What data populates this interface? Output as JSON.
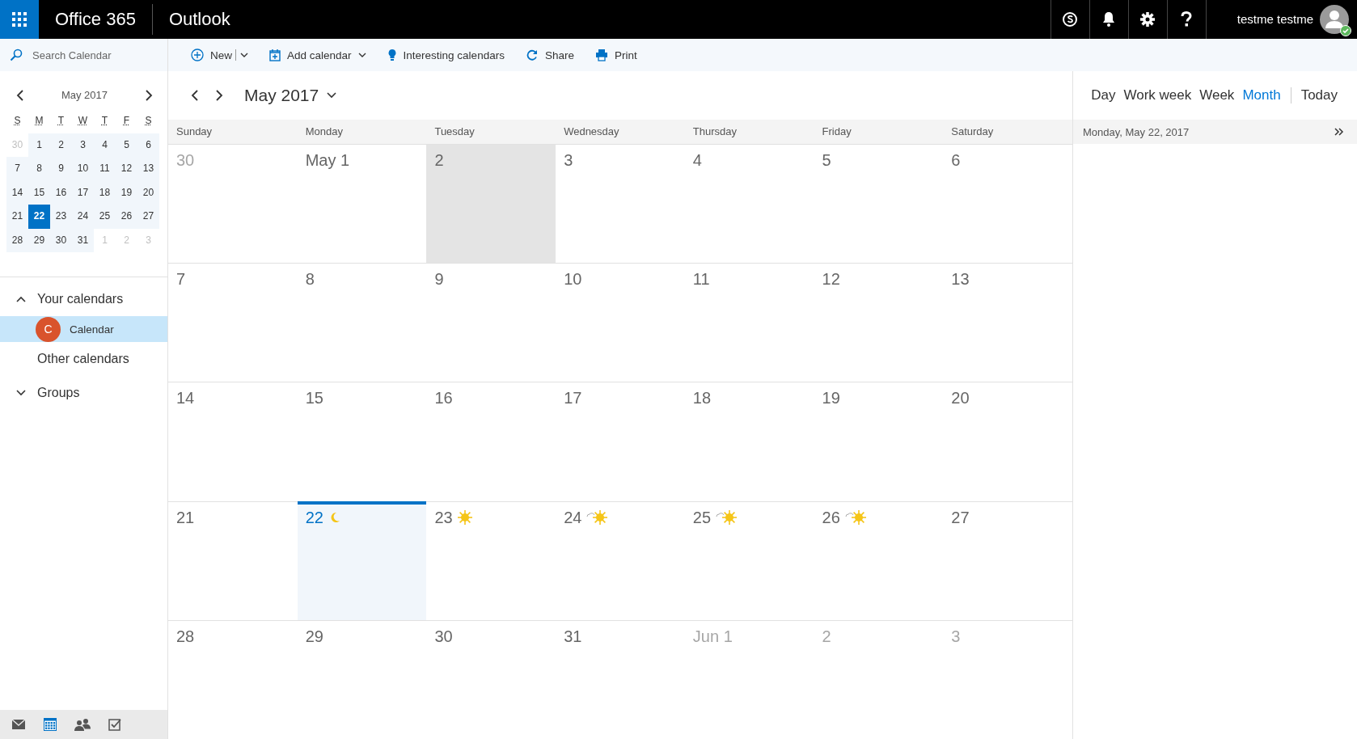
{
  "top_bar": {
    "suite": "Office 365",
    "app": "Outlook",
    "icons": [
      {
        "kind": "skype"
      },
      {
        "kind": "bell"
      },
      {
        "kind": "gear"
      },
      {
        "kind": "help"
      }
    ],
    "user": "testme testme",
    "online": true
  },
  "toolbar": {
    "search": {
      "placeholder": "Search Calendar"
    },
    "actions": [
      {
        "kind": "new",
        "label": "New",
        "split": true,
        "dropdown": true
      },
      {
        "kind": "add",
        "label": "Add calendar",
        "split": false,
        "dropdown": true
      },
      {
        "kind": "bulb",
        "label": "Interesting calendars",
        "split": false,
        "dropdown": false
      },
      {
        "kind": "share",
        "label": "Share",
        "split": false,
        "dropdown": false
      },
      {
        "kind": "print",
        "label": "Print",
        "split": false,
        "dropdown": false
      }
    ]
  },
  "mini_calendar": {
    "title": "May 2017",
    "weekdays": [
      "S",
      "M",
      "T",
      "W",
      "T",
      "F",
      "S"
    ],
    "weeks": [
      [
        {
          "day": "30",
          "muted": true,
          "selected": false
        },
        {
          "day": "1",
          "muted": false,
          "selected": false
        },
        {
          "day": "2",
          "muted": false,
          "selected": false
        },
        {
          "day": "3",
          "muted": false,
          "selected": false
        },
        {
          "day": "4",
          "muted": false,
          "selected": false
        },
        {
          "day": "5",
          "muted": false,
          "selected": false
        },
        {
          "day": "6",
          "muted": false,
          "selected": false
        }
      ],
      [
        {
          "day": "7",
          "muted": false,
          "selected": false
        },
        {
          "day": "8",
          "muted": false,
          "selected": false
        },
        {
          "day": "9",
          "muted": false,
          "selected": false
        },
        {
          "day": "10",
          "muted": false,
          "selected": false
        },
        {
          "day": "11",
          "muted": false,
          "selected": false
        },
        {
          "day": "12",
          "muted": false,
          "selected": false
        },
        {
          "day": "13",
          "muted": false,
          "selected": false
        }
      ],
      [
        {
          "day": "14",
          "muted": false,
          "selected": false
        },
        {
          "day": "15",
          "muted": false,
          "selected": false
        },
        {
          "day": "16",
          "muted": false,
          "selected": false
        },
        {
          "day": "17",
          "muted": false,
          "selected": false
        },
        {
          "day": "18",
          "muted": false,
          "selected": false
        },
        {
          "day": "19",
          "muted": false,
          "selected": false
        },
        {
          "day": "20",
          "muted": false,
          "selected": false
        }
      ],
      [
        {
          "day": "21",
          "muted": false,
          "selected": false
        },
        {
          "day": "22",
          "muted": false,
          "selected": true
        },
        {
          "day": "23",
          "muted": false,
          "selected": false
        },
        {
          "day": "24",
          "muted": false,
          "selected": false
        },
        {
          "day": "25",
          "muted": false,
          "selected": false
        },
        {
          "day": "26",
          "muted": false,
          "selected": false
        },
        {
          "day": "27",
          "muted": false,
          "selected": false
        }
      ],
      [
        {
          "day": "28",
          "muted": false,
          "selected": false
        },
        {
          "day": "29",
          "muted": false,
          "selected": false
        },
        {
          "day": "30",
          "muted": false,
          "selected": false
        },
        {
          "day": "31",
          "muted": false,
          "selected": false
        },
        {
          "day": "1",
          "muted": true,
          "selected": false
        },
        {
          "day": "2",
          "muted": true,
          "selected": false
        },
        {
          "day": "3",
          "muted": true,
          "selected": false
        }
      ]
    ]
  },
  "calendars": {
    "sections": [
      {
        "label": "Your calendars",
        "expanded": true,
        "items": [
          {
            "label": "Calendar",
            "initial": "C",
            "color": "#d9532c",
            "selected": true
          }
        ]
      },
      {
        "label": "Other calendars"
      },
      {
        "label": "Groups",
        "expanded": false
      }
    ]
  },
  "bottom_nav": [
    {
      "kind": "mail",
      "selected": false
    },
    {
      "kind": "calendar",
      "selected": true
    },
    {
      "kind": "people",
      "selected": false
    },
    {
      "kind": "tasks",
      "selected": false
    }
  ],
  "view": {
    "title": "May 2017",
    "modes": [
      {
        "label": "Day",
        "selected": false
      },
      {
        "label": "Work week",
        "selected": false
      },
      {
        "label": "Week",
        "selected": false
      },
      {
        "label": "Month",
        "selected": true
      }
    ],
    "today": "Today"
  },
  "month": {
    "weekdays": [
      "Sunday",
      "Monday",
      "Tuesday",
      "Wednesday",
      "Thursday",
      "Friday",
      "Saturday"
    ],
    "weeks": [
      [
        {
          "day": "30",
          "muted": true,
          "highlighted": false,
          "today": false
        },
        {
          "day": "May 1",
          "muted": false,
          "highlighted": false,
          "today": false
        },
        {
          "day": "2",
          "muted": false,
          "highlighted": true,
          "today": false
        },
        {
          "day": "3",
          "muted": false,
          "highlighted": false,
          "today": false
        },
        {
          "day": "4",
          "muted": false,
          "highlighted": false,
          "today": false
        },
        {
          "day": "5",
          "muted": false,
          "highlighted": false,
          "today": false
        },
        {
          "day": "6",
          "muted": false,
          "highlighted": false,
          "today": false
        }
      ],
      [
        {
          "day": "7",
          "muted": false,
          "highlighted": false,
          "today": false
        },
        {
          "day": "8",
          "muted": false,
          "highlighted": false,
          "today": false
        },
        {
          "day": "9",
          "muted": false,
          "highlighted": false,
          "today": false
        },
        {
          "day": "10",
          "muted": false,
          "highlighted": false,
          "today": false
        },
        {
          "day": "11",
          "muted": false,
          "highlighted": false,
          "today": false
        },
        {
          "day": "12",
          "muted": false,
          "highlighted": false,
          "today": false
        },
        {
          "day": "13",
          "muted": false,
          "highlighted": false,
          "today": false
        }
      ],
      [
        {
          "day": "14",
          "muted": false,
          "highlighted": false,
          "today": false
        },
        {
          "day": "15",
          "muted": false,
          "highlighted": false,
          "today": false
        },
        {
          "day": "16",
          "muted": false,
          "highlighted": false,
          "today": false
        },
        {
          "day": "17",
          "muted": false,
          "highlighted": false,
          "today": false
        },
        {
          "day": "18",
          "muted": false,
          "highlighted": false,
          "today": false
        },
        {
          "day": "19",
          "muted": false,
          "highlighted": false,
          "today": false
        },
        {
          "day": "20",
          "muted": false,
          "highlighted": false,
          "today": false
        }
      ],
      [
        {
          "day": "21",
          "muted": false,
          "highlighted": false,
          "today": false
        },
        {
          "day": "22",
          "muted": false,
          "highlighted": false,
          "today": true,
          "weather": {
            "kind": "moon"
          }
        },
        {
          "day": "23",
          "muted": false,
          "highlighted": false,
          "today": false,
          "weather": {
            "kind": "sun"
          }
        },
        {
          "day": "24",
          "muted": false,
          "highlighted": false,
          "today": false,
          "weather": {
            "kind": "sun-cloud"
          }
        },
        {
          "day": "25",
          "muted": false,
          "highlighted": false,
          "today": false,
          "weather": {
            "kind": "sun-cloud"
          }
        },
        {
          "day": "26",
          "muted": false,
          "highlighted": false,
          "today": false,
          "weather": {
            "kind": "sun-cloud"
          }
        },
        {
          "day": "27",
          "muted": false,
          "highlighted": false,
          "today": false
        }
      ],
      [
        {
          "day": "28",
          "muted": false,
          "highlighted": false,
          "today": false
        },
        {
          "day": "29",
          "muted": false,
          "highlighted": false,
          "today": false
        },
        {
          "day": "30",
          "muted": false,
          "highlighted": false,
          "today": false
        },
        {
          "day": "31",
          "muted": false,
          "highlighted": false,
          "today": false
        },
        {
          "day": "Jun 1",
          "muted": true,
          "highlighted": false,
          "today": false
        },
        {
          "day": "2",
          "muted": true,
          "highlighted": false,
          "today": false
        },
        {
          "day": "3",
          "muted": true,
          "highlighted": false,
          "today": false
        }
      ]
    ]
  },
  "agenda": {
    "date": "Monday, May 22, 2017"
  }
}
